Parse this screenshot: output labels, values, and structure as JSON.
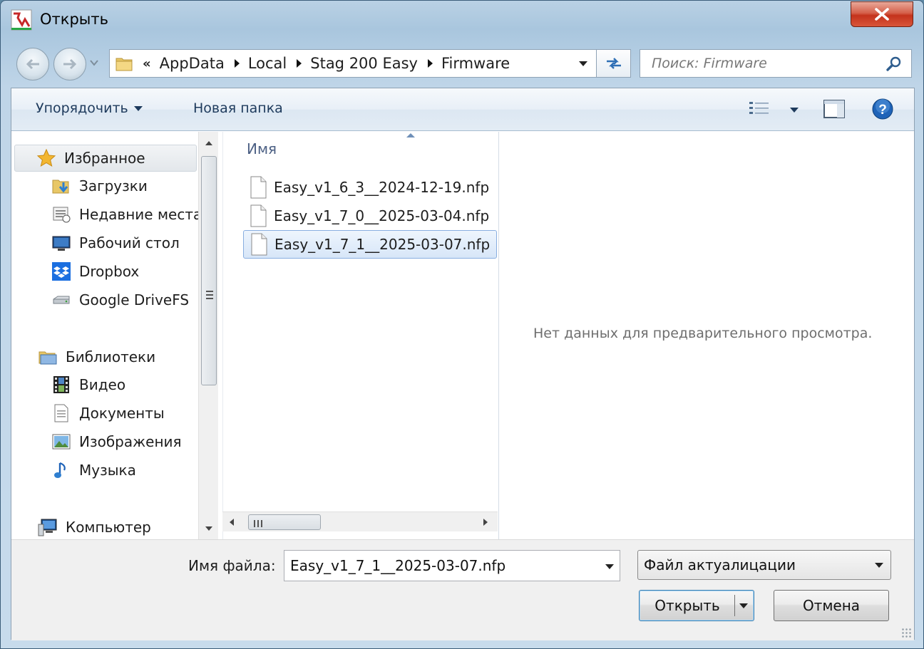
{
  "window": {
    "title": "Открыть"
  },
  "address_bar": {
    "overflow": "«",
    "crumbs": [
      "AppData",
      "Local",
      "Stag 200 Easy",
      "Firmware"
    ]
  },
  "search": {
    "placeholder": "Поиск: Firmware"
  },
  "toolbar": {
    "organize": "Упорядочить",
    "new_folder": "Новая папка"
  },
  "navigation": {
    "favorites": {
      "label": "Избранное",
      "items": [
        "Загрузки",
        "Недавние места",
        "Рабочий стол",
        "Dropbox",
        "Google DriveFS"
      ]
    },
    "libraries": {
      "label": "Библиотеки",
      "items": [
        "Видео",
        "Документы",
        "Изображения",
        "Музыка"
      ]
    },
    "computer": {
      "label": "Компьютер"
    }
  },
  "file_list": {
    "column_name": "Имя",
    "files": [
      "Easy_v1_6_3__2024-12-19.nfp",
      "Easy_v1_7_0__2025-03-04.nfp",
      "Easy_v1_7_1__2025-03-07.nfp"
    ],
    "selected_index": 2
  },
  "preview": {
    "message": "Нет данных для предварительного просмотра."
  },
  "footer": {
    "filename_label": "Имя файла:",
    "filename_value": "Easy_v1_7_1__2025-03-07.nfp",
    "filetype_value": "Файл актуалицации",
    "open_button": "Открыть",
    "cancel_button": "Отмена"
  },
  "colors": {
    "selection_border": "#88aee0",
    "toolbar_text": "#1e3a5c",
    "help_icon": "#1f63b8"
  }
}
